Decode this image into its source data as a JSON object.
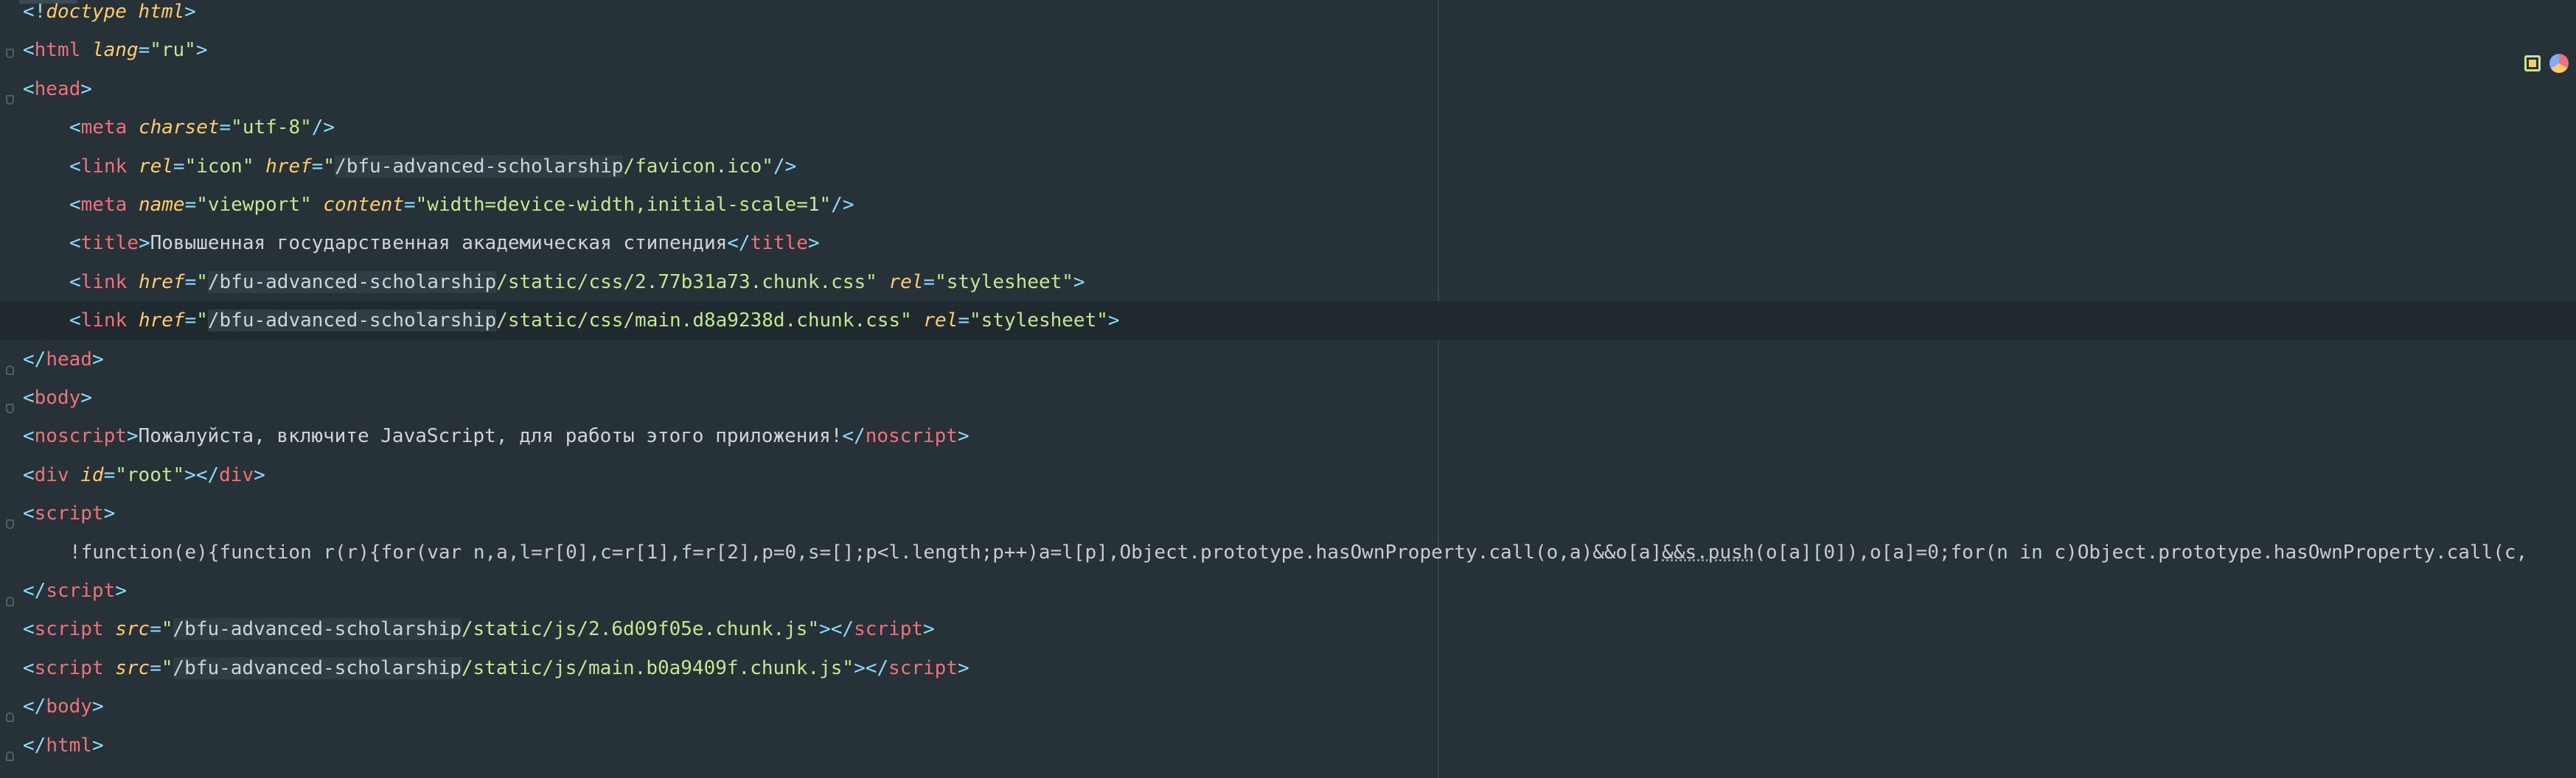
{
  "editor": {
    "language": "html",
    "lines": [
      {
        "tokens": [
          [
            "punct",
            "<!"
          ],
          [
            "doctype",
            "doctype html"
          ],
          [
            "punct",
            ">"
          ]
        ]
      },
      {
        "tokens": [
          [
            "punct",
            "<"
          ],
          [
            "tag",
            "html "
          ],
          [
            "attr",
            "lang"
          ],
          [
            "punct",
            "="
          ],
          [
            "str",
            "\"ru\""
          ],
          [
            "punct",
            ">"
          ]
        ]
      },
      {
        "tokens": [
          [
            "punct",
            "<"
          ],
          [
            "tag",
            "head"
          ],
          [
            "punct",
            ">"
          ]
        ]
      },
      {
        "tokens": [
          [
            "punct",
            "<"
          ],
          [
            "tag",
            "meta "
          ],
          [
            "attr",
            "charset"
          ],
          [
            "punct",
            "="
          ],
          [
            "str",
            "\"utf-8\""
          ],
          [
            "punct",
            "/>"
          ]
        ]
      },
      {
        "tokens": [
          [
            "punct",
            "<"
          ],
          [
            "tag",
            "link "
          ],
          [
            "attr",
            "rel"
          ],
          [
            "punct",
            "="
          ],
          [
            "str",
            "\"icon\" "
          ],
          [
            "attr",
            "href"
          ],
          [
            "punct",
            "="
          ],
          [
            "str",
            "\""
          ],
          [
            "path",
            "/bfu-advanced-scholarship"
          ],
          [
            "str",
            "/favicon.ico\""
          ],
          [
            "punct",
            "/>"
          ]
        ]
      },
      {
        "tokens": [
          [
            "punct",
            "<"
          ],
          [
            "tag",
            "meta "
          ],
          [
            "attr",
            "name"
          ],
          [
            "punct",
            "="
          ],
          [
            "str",
            "\"viewport\" "
          ],
          [
            "attr",
            "content"
          ],
          [
            "punct",
            "="
          ],
          [
            "str",
            "\"width=device-width,initial-scale=1\""
          ],
          [
            "punct",
            "/>"
          ]
        ]
      },
      {
        "tokens": [
          [
            "punct",
            "<"
          ],
          [
            "tag",
            "title"
          ],
          [
            "punct",
            ">"
          ],
          [
            "text",
            "Повышенная государственная академическая стипендия"
          ],
          [
            "punct",
            "</"
          ],
          [
            "tag",
            "title"
          ],
          [
            "punct",
            ">"
          ]
        ]
      },
      {
        "tokens": [
          [
            "punct",
            "<"
          ],
          [
            "tag",
            "link "
          ],
          [
            "attr",
            "href"
          ],
          [
            "punct",
            "="
          ],
          [
            "str",
            "\""
          ],
          [
            "path",
            "/bfu-advanced-scholarship"
          ],
          [
            "str",
            "/static/css/2.77b31a73.chunk.css\" "
          ],
          [
            "attr",
            "rel"
          ],
          [
            "punct",
            "="
          ],
          [
            "str",
            "\"stylesheet\""
          ],
          [
            "punct",
            ">"
          ]
        ]
      },
      {
        "tokens": [
          [
            "punct",
            "<"
          ],
          [
            "tag",
            "link "
          ],
          [
            "attr",
            "href"
          ],
          [
            "punct",
            "="
          ],
          [
            "str",
            "\""
          ],
          [
            "path",
            "/bfu-advanced-scholarship"
          ],
          [
            "str",
            "/static/css/main.d8a9238d.chunk.css\" "
          ],
          [
            "attr",
            "rel"
          ],
          [
            "punct",
            "="
          ],
          [
            "str",
            "\"stylesheet\""
          ],
          [
            "punct",
            ">"
          ]
        ]
      },
      {
        "tokens": [
          [
            "punct",
            "</"
          ],
          [
            "tag",
            "head"
          ],
          [
            "punct",
            ">"
          ]
        ]
      },
      {
        "tokens": [
          [
            "punct",
            "<"
          ],
          [
            "tag",
            "body"
          ],
          [
            "punct",
            ">"
          ]
        ]
      },
      {
        "tokens": [
          [
            "punct",
            "<"
          ],
          [
            "tag",
            "noscript"
          ],
          [
            "punct",
            ">"
          ],
          [
            "text",
            "Пожалуйста, включите JavaScript, для работы этого приложения!"
          ],
          [
            "punct",
            "</"
          ],
          [
            "tag",
            "noscript"
          ],
          [
            "punct",
            ">"
          ]
        ]
      },
      {
        "tokens": [
          [
            "punct",
            "<"
          ],
          [
            "tag",
            "div "
          ],
          [
            "attr",
            "id"
          ],
          [
            "punct",
            "="
          ],
          [
            "str",
            "\"root\""
          ],
          [
            "punct",
            "></"
          ],
          [
            "tag",
            "div"
          ],
          [
            "punct",
            ">"
          ]
        ]
      },
      {
        "tokens": [
          [
            "punct",
            "<"
          ],
          [
            "tag",
            "script"
          ],
          [
            "punct",
            ">"
          ]
        ]
      },
      {
        "tokens": [
          [
            "js",
            "!function(e){function r(r){for(var n,a,l=r[0],c=r[1],f=r[2],p=0,s=[];p<l.length;p++)a=l[p],Object.prototype.hasOwnProperty.call(o,a)&&o[a]"
          ],
          [
            "jsu",
            "&&s.push"
          ],
          [
            "js",
            "(o[a][0]),o[a]=0;for(n in c)Object.prototype.hasOwnProperty.call(c,"
          ]
        ]
      },
      {
        "tokens": [
          [
            "punct",
            "</"
          ],
          [
            "tag",
            "script"
          ],
          [
            "punct",
            ">"
          ]
        ]
      },
      {
        "tokens": [
          [
            "punct",
            "<"
          ],
          [
            "tag",
            "script "
          ],
          [
            "attr",
            "src"
          ],
          [
            "punct",
            "="
          ],
          [
            "str",
            "\""
          ],
          [
            "path",
            "/bfu-advanced-scholarship"
          ],
          [
            "str",
            "/static/js/2.6d09f05e.chunk.js\""
          ],
          [
            "punct",
            "></"
          ],
          [
            "tag",
            "script"
          ],
          [
            "punct",
            ">"
          ]
        ]
      },
      {
        "tokens": [
          [
            "punct",
            "<"
          ],
          [
            "tag",
            "script "
          ],
          [
            "attr",
            "src"
          ],
          [
            "punct",
            "="
          ],
          [
            "str",
            "\""
          ],
          [
            "path",
            "/bfu-advanced-scholarship"
          ],
          [
            "str",
            "/static/js/main.b0a9409f.chunk.js\""
          ],
          [
            "punct",
            "></"
          ],
          [
            "tag",
            "script"
          ],
          [
            "punct",
            ">"
          ]
        ]
      },
      {
        "tokens": [
          [
            "punct",
            "</"
          ],
          [
            "tag",
            "body"
          ],
          [
            "punct",
            ">"
          ]
        ]
      },
      {
        "tokens": [
          [
            "punct",
            "</"
          ],
          [
            "tag",
            "html"
          ],
          [
            "punct",
            ">"
          ]
        ]
      }
    ]
  },
  "side_icons": [
    "html-preview-icon",
    "browser-icon"
  ]
}
